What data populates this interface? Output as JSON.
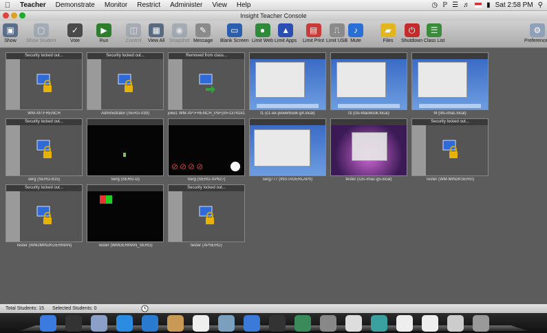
{
  "menubar": {
    "app": "Teacher",
    "items": [
      "Demonstrate",
      "Monitor",
      "Restrict",
      "Administer",
      "View",
      "Help"
    ],
    "clock": "Sat 2:58 PM"
  },
  "window": {
    "title": "Insight Teacher Console"
  },
  "toolbar": {
    "items": [
      {
        "label": "Show",
        "icon": "monitor-icon",
        "enabled": true
      },
      {
        "label": "Show Student",
        "icon": "student-screen-icon",
        "enabled": false
      },
      {
        "label": "Vote",
        "icon": "vote-icon",
        "enabled": true
      },
      {
        "label": "Run",
        "icon": "run-icon",
        "enabled": true
      },
      {
        "label": "Control",
        "icon": "control-icon",
        "enabled": false
      },
      {
        "label": "View All",
        "icon": "view-all-icon",
        "enabled": true
      },
      {
        "label": "Snapshot",
        "icon": "snapshot-icon",
        "enabled": false
      },
      {
        "label": "Message",
        "icon": "message-icon",
        "enabled": true
      },
      {
        "label": "Blank Screen",
        "icon": "blank-screen-icon",
        "enabled": true
      },
      {
        "label": "Limit Web",
        "icon": "limit-web-icon",
        "enabled": true
      },
      {
        "label": "Limit Apps",
        "icon": "limit-apps-icon",
        "enabled": true
      },
      {
        "label": "Limit Print",
        "icon": "limit-print-icon",
        "enabled": true
      },
      {
        "label": "Limit USB",
        "icon": "limit-usb-icon",
        "enabled": true
      },
      {
        "label": "Mute",
        "icon": "mute-icon",
        "enabled": true
      },
      {
        "label": "Files",
        "icon": "files-icon",
        "enabled": true
      },
      {
        "label": "Shutdown",
        "icon": "shutdown-icon",
        "enabled": true
      },
      {
        "label": "Class List",
        "icon": "class-list-icon",
        "enabled": true
      },
      {
        "label": "Preferences",
        "icon": "preferences-icon",
        "enabled": true
      }
    ]
  },
  "students": [
    {
      "header": "Security locked out...",
      "caption": "WM-XP-FRENCH",
      "screen": "locked"
    },
    {
      "header": "Security locked out...",
      "caption": "Administrator (SERG-039)",
      "screen": "locked"
    },
    {
      "header": "Removed from class...",
      "caption": "joke1 WM-XP-FRENCH_PoF(nt=1374181)",
      "screen": "removed"
    },
    {
      "header": "",
      "caption": "t1 (c1-ex-powerbook-g4.local)",
      "screen": "mac-blue"
    },
    {
      "header": "",
      "caption": "t3 (t3s-MacBook.local)",
      "screen": "mac-finder"
    },
    {
      "header": "",
      "caption": "t4 (t4s-imac.local)",
      "screen": "mac-blue"
    },
    {
      "header": "Security locked out...",
      "caption": "serg (SERG-815)",
      "screen": "locked"
    },
    {
      "header": "",
      "caption": "Serg (SERG-D)",
      "screen": "black"
    },
    {
      "header": "",
      "caption": "Serg (SERG-XP627)",
      "screen": "limits"
    },
    {
      "header": "",
      "caption": "serg777 (INSTAGERLAP0)",
      "screen": "win-blue"
    },
    {
      "header": "",
      "caption": "tester (s3s-imac-g5.local)",
      "screen": "mac-purple"
    },
    {
      "header": "Security locked out...",
      "caption": "Tester (WM-MIN2KSERG)",
      "screen": "locked"
    },
    {
      "header": "Security locked out...",
      "caption": "Tester (WM2MIN2KGERMAN)",
      "screen": "locked"
    },
    {
      "header": "",
      "caption": "Tester (WMGERMAN_SERG)",
      "screen": "winxp-boot"
    },
    {
      "header": "Security locked out...",
      "caption": "tester (XPSERG)",
      "screen": "locked"
    }
  ],
  "status": {
    "total": "Total Students: 15",
    "selected": "Selected Students: 0"
  },
  "colors": {
    "accent": "#2a6fd6",
    "lock": "#e6b400",
    "locked_bg": "#555555"
  }
}
